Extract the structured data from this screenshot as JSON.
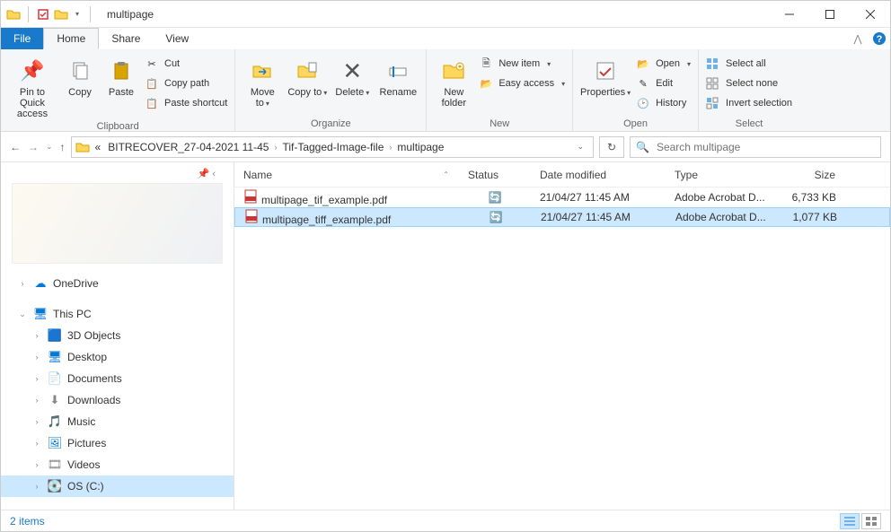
{
  "window": {
    "title": "multipage"
  },
  "tabs": {
    "file": "File",
    "home": "Home",
    "share": "Share",
    "view": "View"
  },
  "ribbon": {
    "clipboard": {
      "label": "Clipboard",
      "pin": "Pin to Quick access",
      "copy": "Copy",
      "paste": "Paste",
      "cut": "Cut",
      "copypath": "Copy path",
      "pasteshortcut": "Paste shortcut"
    },
    "organize": {
      "label": "Organize",
      "moveto": "Move to",
      "copyto": "Copy to",
      "delete": "Delete",
      "rename": "Rename"
    },
    "new": {
      "label": "New",
      "newfolder": "New folder",
      "newitem": "New item",
      "easyaccess": "Easy access"
    },
    "open": {
      "label": "Open",
      "properties": "Properties",
      "open": "Open",
      "edit": "Edit",
      "history": "History"
    },
    "select": {
      "label": "Select",
      "selectall": "Select all",
      "selectnone": "Select none",
      "invert": "Invert selection"
    }
  },
  "nav": {
    "crumbs": [
      "BITRECOVER_27-04-2021 11-45",
      "Tif-Tagged-Image-file",
      "multipage"
    ],
    "search_placeholder": "Search multipage"
  },
  "sidebar": {
    "onedrive": "OneDrive",
    "thispc": "This PC",
    "items": [
      "3D Objects",
      "Desktop",
      "Documents",
      "Downloads",
      "Music",
      "Pictures",
      "Videos",
      "OS (C:)"
    ]
  },
  "columns": {
    "name": "Name",
    "status": "Status",
    "date": "Date modified",
    "type": "Type",
    "size": "Size"
  },
  "files": [
    {
      "name": "multipage_tif_example.pdf",
      "date": "21/04/27 11:45 AM",
      "type": "Adobe Acrobat D...",
      "size": "6,733 KB"
    },
    {
      "name": "multipage_tiff_example.pdf",
      "date": "21/04/27 11:45 AM",
      "type": "Adobe Acrobat D...",
      "size": "1,077 KB"
    }
  ],
  "status": {
    "items": "2 items"
  }
}
